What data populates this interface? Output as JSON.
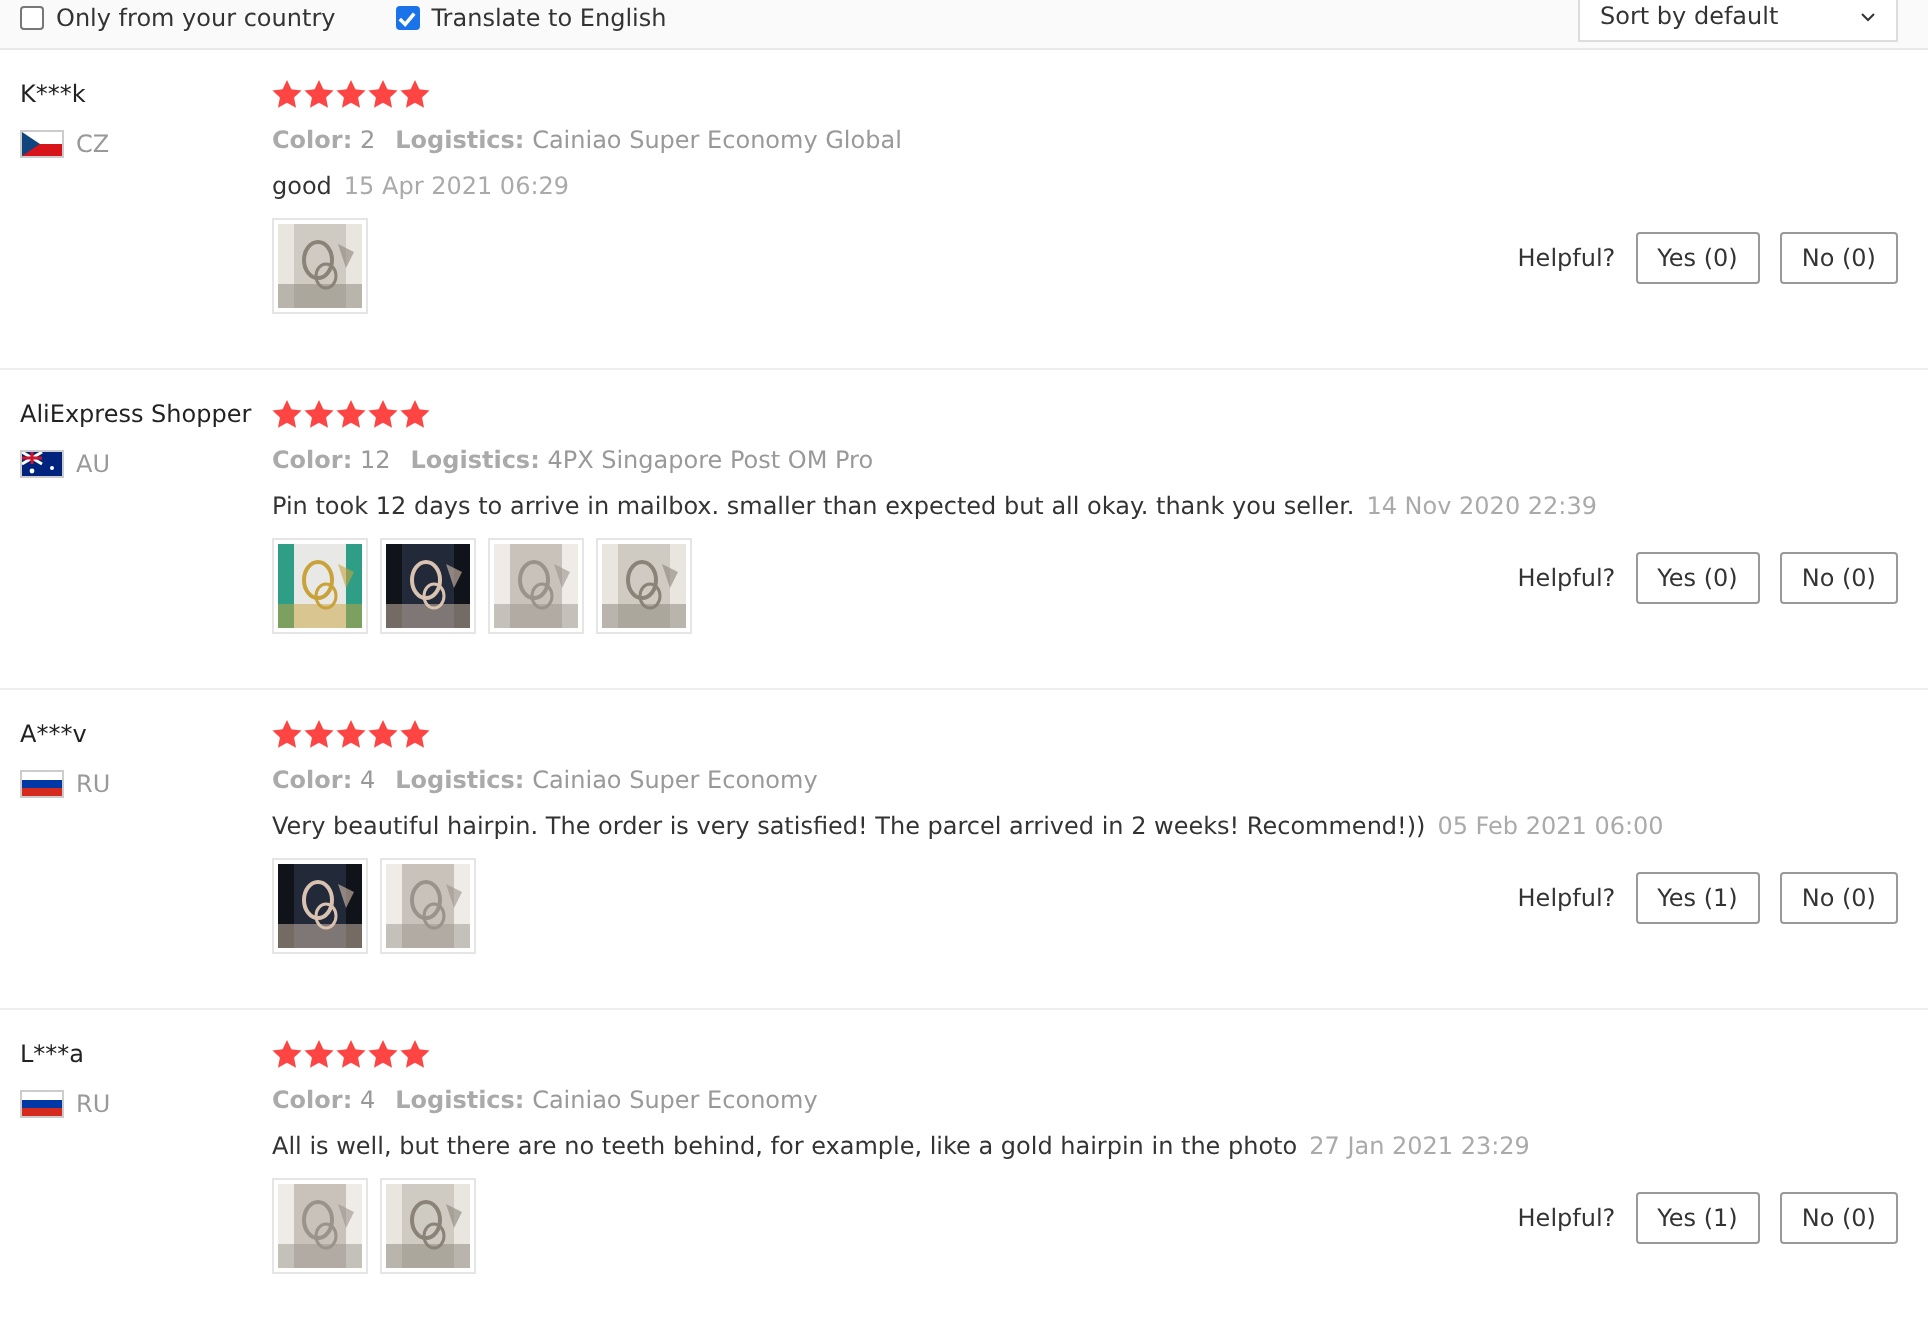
{
  "filters": {
    "only_country": {
      "label": "Only from your country",
      "checked": false
    },
    "translate": {
      "label": "Translate to English",
      "checked": true
    },
    "sort": {
      "value": "Sort by default"
    }
  },
  "reviews": [
    {
      "name": "K***k",
      "kind": "cz",
      "country": "CZ",
      "stars": 5,
      "color_label": "Color:",
      "color_value": "2",
      "logistics_label": "Logistics:",
      "logistics": "Cainiao Super Economy Global",
      "comment": "good",
      "date": "15 Apr 2021 06:29",
      "photos": [
        {
          "kind": "picture"
        }
      ],
      "helpful": "Helpful?",
      "yes": "Yes (0)",
      "no": "No (0)"
    },
    {
      "name": "AliExpress Shopper",
      "kind": "au",
      "country": "AU",
      "stars": 5,
      "color_label": "Color:",
      "color_value": "12",
      "logistics_label": "Logistics:",
      "logistics": "4PX Singapore Post OM Pro",
      "comment": "Pin took 12 days to arrive in mailbox. smaller than expected but all okay. thank you seller.",
      "date": "14 Nov 2020 22:39",
      "photos": [
        {
          "kind": "picture"
        },
        {
          "kind": "picture"
        },
        {
          "kind": "picture"
        },
        {
          "kind": "picture"
        }
      ],
      "helpful": "Helpful?",
      "yes": "Yes (0)",
      "no": "No (0)"
    },
    {
      "name": "A***v",
      "kind": "ru",
      "country": "RU",
      "stars": 5,
      "color_label": "Color:",
      "color_value": "4",
      "logistics_label": "Logistics:",
      "logistics": "Cainiao Super Economy",
      "comment": "Very beautiful hairpin. The order is very satisfied! The parcel arrived in 2 weeks! Recommend!))",
      "date": "05 Feb 2021 06:00",
      "photos": [
        {
          "kind": "picture"
        },
        {
          "kind": "picture"
        }
      ],
      "helpful": "Helpful?",
      "yes": "Yes (1)",
      "no": "No (0)"
    },
    {
      "name": "L***a",
      "kind": "ru",
      "country": "RU",
      "stars": 5,
      "color_label": "Color:",
      "color_value": "4",
      "logistics_label": "Logistics:",
      "logistics": "Cainiao Super Economy",
      "comment": "All is well, but there are no teeth behind, for example, like a gold hairpin in the photo",
      "date": "27 Jan 2021 23:29",
      "photos": [
        {
          "kind": "picture"
        },
        {
          "kind": "picture"
        }
      ],
      "helpful": "Helpful?",
      "yes": "Yes (1)",
      "no": "No (0)"
    }
  ]
}
